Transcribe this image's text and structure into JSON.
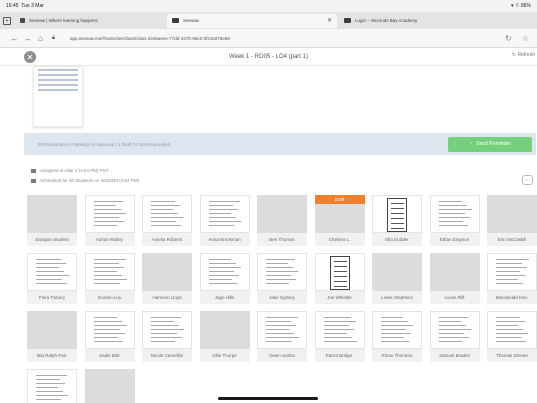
{
  "status_bar": {
    "time": "16:45",
    "date": "Tue 3 Mar",
    "indicators": "▾ ⌔ 86%"
  },
  "tabs": [
    {
      "label": "Seesaw | Where learning happens",
      "active": false
    },
    {
      "label": "Seesaw",
      "active": true
    },
    {
      "label": "Login – Seconds Bay Academy",
      "active": false
    }
  ],
  "address": {
    "url": "app.seesaw.me/#/activities/class/class.4346aeee-77dd-437b-96c0-0f216d78e68"
  },
  "header": {
    "title": "Week 1 - RO05 - LO4 (part 1)",
    "refresh_label": "Refresh"
  },
  "response_bar": {
    "summary": "25 Responses  |  0 Waiting for Approval  |  1 Draft  |  0 Not Responded",
    "send_label": "Send Reminder"
  },
  "meta": {
    "assigned": "Assigned on Mar 2 (4:54 PM) PST",
    "scheduled": "Scheduled for 30 Students on 3/2/2020 (4:54 PM)"
  },
  "students": [
    {
      "name": "Sampan Student",
      "style": "plain",
      "draft": false
    },
    {
      "name": "Adrian Mulley",
      "style": "doc",
      "draft": false
    },
    {
      "name": "Amelia Roberts",
      "style": "doc",
      "draft": false
    },
    {
      "name": "Anna Brookman",
      "style": "doc",
      "draft": false
    },
    {
      "name": "Ben Thomas",
      "style": "plain",
      "draft": false
    },
    {
      "name": "Chelsea L.",
      "style": "plain",
      "draft": true
    },
    {
      "name": "Ella Dudder",
      "style": "dark-doc",
      "draft": false
    },
    {
      "name": "Ethan Empson",
      "style": "doc",
      "draft": false
    },
    {
      "name": "Erin McCaskill",
      "style": "plain",
      "draft": false
    },
    {
      "name": "Flora Tisbury",
      "style": "doc",
      "draft": false
    },
    {
      "name": "Gordon Lou",
      "style": "doc",
      "draft": false
    },
    {
      "name": "Harrison Lloyd",
      "style": "plain",
      "draft": false
    },
    {
      "name": "Jago Hills",
      "style": "doc",
      "draft": false
    },
    {
      "name": "Jake Sydney",
      "style": "doc",
      "draft": false
    },
    {
      "name": "Joe Whistler",
      "style": "dark-doc",
      "draft": false
    },
    {
      "name": "Lewis Stephens",
      "style": "plain",
      "draft": false
    },
    {
      "name": "Lucas Riff",
      "style": "plain",
      "draft": false
    },
    {
      "name": "Macdonald Ken.",
      "style": "doc",
      "draft": false
    },
    {
      "name": "Mia Ralph-Fair.",
      "style": "plain",
      "draft": false
    },
    {
      "name": "Sadie Bidr",
      "style": "doc",
      "draft": false
    },
    {
      "name": "Nicole Camellini",
      "style": "doc",
      "draft": false
    },
    {
      "name": "Ollie Thorpe",
      "style": "plain",
      "draft": false
    },
    {
      "name": "Owen Sutton",
      "style": "doc",
      "draft": false
    },
    {
      "name": "Parrot Bridge.",
      "style": "doc",
      "draft": false
    },
    {
      "name": "Rhian Thornton",
      "style": "doc",
      "draft": false
    },
    {
      "name": "Samuel Brades",
      "style": "doc",
      "draft": false
    },
    {
      "name": "Thomas Dineen",
      "style": "doc",
      "draft": false
    },
    {
      "name": "",
      "style": "doc",
      "draft": false
    },
    {
      "name": "",
      "style": "plain",
      "draft": false
    }
  ],
  "draft_label": "Draft",
  "colors": {
    "send": "#74d07c",
    "draft": "#f07f2e",
    "response_bar": "#dde6ee"
  }
}
